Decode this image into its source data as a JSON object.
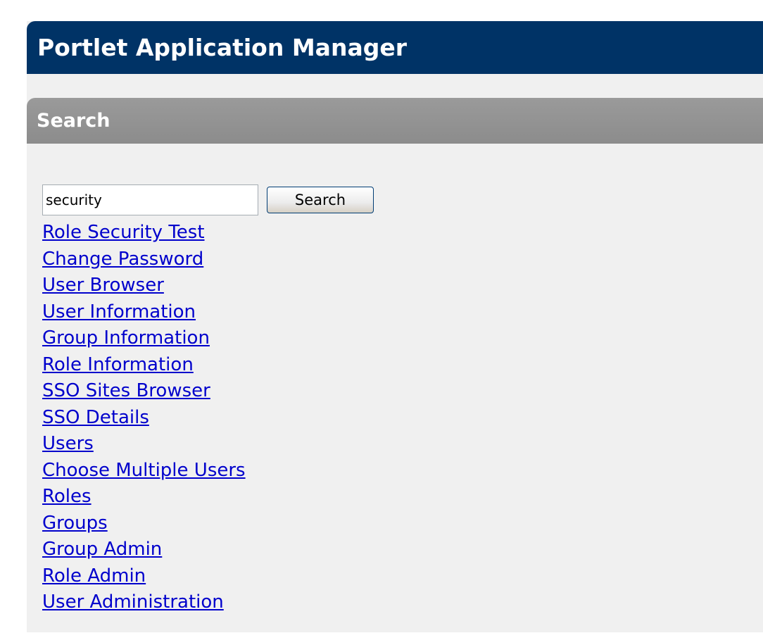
{
  "header": {
    "title": "Portlet Application Manager"
  },
  "section": {
    "title": "Search"
  },
  "search": {
    "value": "security",
    "button_label": "Search"
  },
  "results": [
    {
      "label": "Role Security Test"
    },
    {
      "label": "Change Password"
    },
    {
      "label": "User Browser"
    },
    {
      "label": "User Information"
    },
    {
      "label": "Group Information"
    },
    {
      "label": "Role Information"
    },
    {
      "label": "SSO Sites Browser"
    },
    {
      "label": "SSO Details"
    },
    {
      "label": "Users"
    },
    {
      "label": "Choose Multiple Users"
    },
    {
      "label": "Roles"
    },
    {
      "label": "Groups"
    },
    {
      "label": "Group Admin"
    },
    {
      "label": "Role Admin"
    },
    {
      "label": "User Administration"
    }
  ],
  "colors": {
    "title_bar": "#003366",
    "section_bar": "#8c8c8c",
    "panel_background": "#f0f0f0",
    "link": "#0000cc"
  }
}
